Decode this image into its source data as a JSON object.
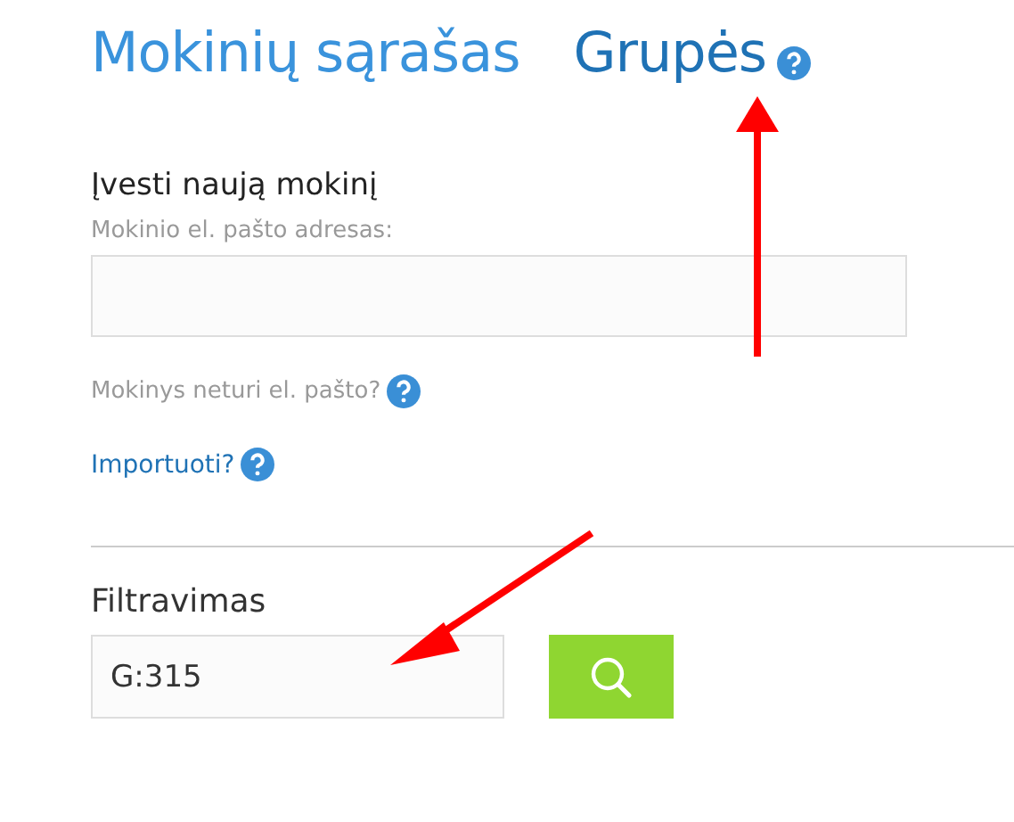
{
  "tabs": [
    {
      "label": "Mokinių sąrašas",
      "selected": false
    },
    {
      "label": "Grupės",
      "selected": true
    }
  ],
  "new_student": {
    "heading": "Įvesti naują mokinį",
    "email_label": "Mokinio el. pašto adresas:",
    "no_email_text": "Mokinys neturi el. pašto?",
    "import_link": "Importuoti?"
  },
  "filter": {
    "heading": "Filtravimas",
    "value": "G:315"
  }
}
